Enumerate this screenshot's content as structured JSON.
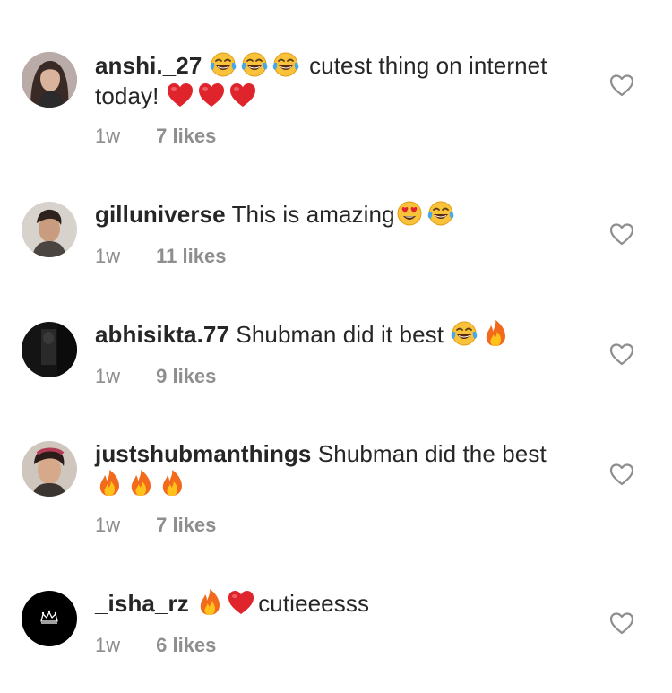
{
  "comments": [
    {
      "username": "anshi._27",
      "avatar_icon": "profile-photo-girl",
      "emojis_before": [
        "face-with-tears-of-joy",
        "face-with-tears-of-joy",
        "face-with-tears-of-joy"
      ],
      "text": "cutest thing on internet today!",
      "emojis_after": [
        "red-heart",
        "red-heart",
        "red-heart"
      ],
      "time": "1w",
      "likes": "7 likes"
    },
    {
      "username": "gilluniverse",
      "avatar_icon": "profile-photo-man",
      "text": "This is amazing",
      "emojis_after": [
        "smiling-face-with-heart-eyes",
        "face-with-tears-of-joy"
      ],
      "time": "1w",
      "likes": "11 likes"
    },
    {
      "username": "abhisikta.77",
      "avatar_icon": "profile-photo-dark",
      "text": "Shubman did it best",
      "emojis_after": [
        "face-with-tears-of-joy",
        "fire"
      ],
      "time": "1w",
      "likes": "9 likes"
    },
    {
      "username": "justshubmanthings",
      "avatar_icon": "profile-photo-man-2",
      "text": "Shubman did the best",
      "emojis_after": [
        "fire",
        "fire",
        "fire"
      ],
      "time": "1w",
      "likes": "7 likes"
    },
    {
      "username": "_isha_rz",
      "avatar_icon": "crown-logo",
      "emojis_before": [
        "fire",
        "red-heart"
      ],
      "text": "cutieeesss",
      "time": "1w",
      "likes": "6 likes"
    }
  ],
  "icons": {
    "like": "heart-outline-icon"
  },
  "colors": {
    "text": "#262626",
    "meta": "#8e8e8e",
    "heart_outline": "#8e8e8e"
  }
}
